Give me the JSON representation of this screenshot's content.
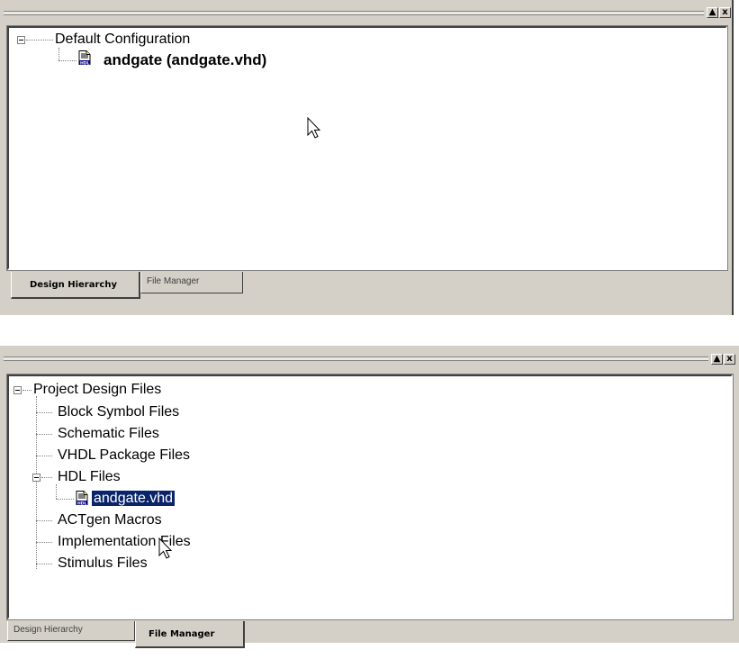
{
  "top_panel": {
    "tree": {
      "root": "Default Configuration",
      "child": "andgate (andgate.vhd)"
    },
    "tabs": [
      "Design Hierarchy",
      "File Manager"
    ],
    "active_tab": "Design Hierarchy"
  },
  "bottom_panel": {
    "tree": {
      "root": "Project Design Files",
      "items": [
        "Block Symbol Files",
        "Schematic Files",
        "VHDL Package Files",
        "HDL Files",
        "andgate.vhd",
        "ACTgen Macros",
        "Implementation Files",
        "Stimulus Files"
      ]
    },
    "tabs": [
      "Design Hierarchy",
      "File Manager"
    ],
    "active_tab": "File Manager"
  },
  "controls": {
    "restore": "▲",
    "close": "x"
  },
  "icons": {
    "hdl_file": "hdl-file-icon"
  },
  "colors": {
    "selection": "#0a246a",
    "panel": "#d4d0c8"
  }
}
